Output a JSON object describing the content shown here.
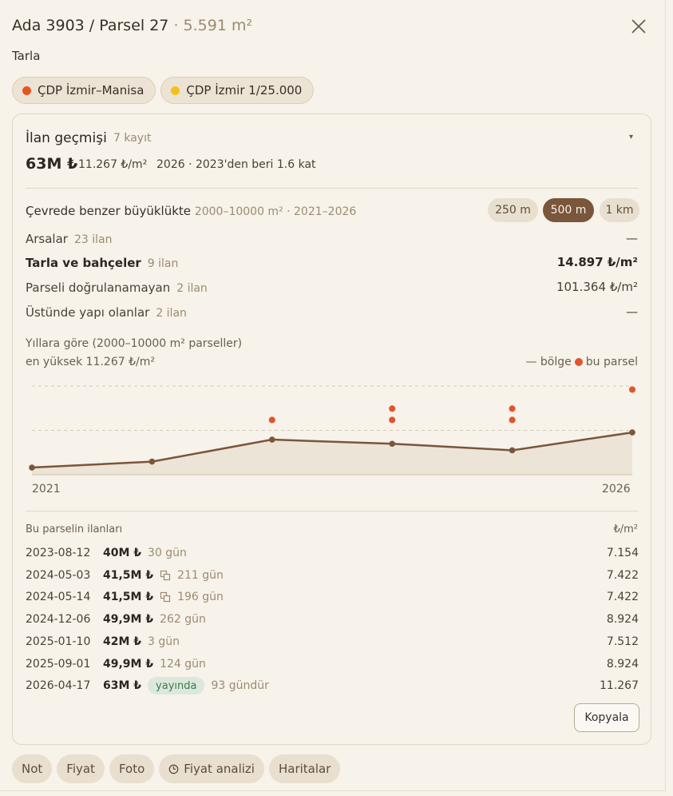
{
  "header": {
    "title": "Ada 3903 / Parsel 27",
    "area": "· 5.591 m²",
    "subtitle": "Tarla"
  },
  "chips": [
    {
      "label": "ÇDP İzmir–Manisa",
      "color": "#e8541e"
    },
    {
      "label": "ÇDP İzmir 1/25.000",
      "color": "#f2c21b"
    }
  ],
  "history": {
    "title": "İlan geçmişi",
    "count": "7 kayıt",
    "price": "63M ₺",
    "ppm": "11.267 ₺/m²",
    "meta": "2026 · 2023'den beri 1.6 kat",
    "caret": "▾"
  },
  "nearby": {
    "label": "Çevrede benzer büyüklükte",
    "range": "2000–10000 m² · 2021–2026",
    "radius_options": [
      "250 m",
      "500 m",
      "1 km"
    ],
    "active_radius": "500 m",
    "rows": [
      {
        "label": "Arsalar",
        "count": "23 ilan",
        "value": "—"
      },
      {
        "label": "Tarla ve bahçeler",
        "count": "9 ilan",
        "value": "14.897 ₺/m²"
      },
      {
        "label": "Parseli doğrulanamayan",
        "count": "2 ilan",
        "value": "101.364 ₺/m²"
      },
      {
        "label": "Üstünde yapı olanlar",
        "count": "2 ilan",
        "value": "—"
      }
    ]
  },
  "chart_data": {
    "type": "line",
    "title": "Yıllara göre (2000–10000 m² parseller)",
    "subtitle": "en yüksek 11.267 ₺/m²",
    "legend": [
      "— bölge",
      "bu parsel"
    ],
    "x_labels": [
      "2021",
      "2026"
    ],
    "x": [
      2021,
      2022,
      2023,
      2024,
      2025,
      2026
    ],
    "region_series": {
      "name": "bölge",
      "values": [
        1200,
        2200,
        5900,
        5200,
        4100,
        7100
      ]
    },
    "parcel_points": [
      {
        "x": 2023,
        "y": 9200
      },
      {
        "x": 2024,
        "y": 11100
      },
      {
        "x": 2024,
        "y": 9200
      },
      {
        "x": 2025,
        "y": 11100
      },
      {
        "x": 2025,
        "y": 9200
      },
      {
        "x": 2026,
        "y": 14300
      }
    ],
    "ylim": [
      0,
      14900
    ],
    "gridlines": [
      7450,
      14900
    ],
    "colors": {
      "region": "#7a563a",
      "fill": "#ede4d8",
      "parcel": "#e0552e"
    }
  },
  "listings": {
    "title": "Bu parselin ilanları",
    "unit_header": "₺/m²",
    "items": [
      {
        "date": "2023-08-12",
        "price": "40M ₺",
        "days": "30 gün",
        "ppm": "7.154"
      },
      {
        "date": "2024-05-03",
        "price": "41,5M ₺",
        "days": "211 gün",
        "ppm": "7.422",
        "dup": true
      },
      {
        "date": "2024-05-14",
        "price": "41,5M ₺",
        "days": "196 gün",
        "ppm": "7.422",
        "dup": true
      },
      {
        "date": "2024-12-06",
        "price": "49,9M ₺",
        "days": "262 gün",
        "ppm": "8.924"
      },
      {
        "date": "2025-01-10",
        "price": "42M ₺",
        "days": "3 gün",
        "ppm": "7.512"
      },
      {
        "date": "2025-09-01",
        "price": "49,9M ₺",
        "days": "124 gün",
        "ppm": "8.924"
      },
      {
        "date": "2026-04-17",
        "price": "63M ₺",
        "badge": "yayında",
        "days": "93 gündür",
        "ppm": "11.267"
      }
    ],
    "copy_label": "Kopyala"
  },
  "bottom_tabs": {
    "note": "Not",
    "price": "Fiyat",
    "photo": "Foto",
    "analysis": "Fiyat analizi",
    "maps": "Haritalar"
  }
}
